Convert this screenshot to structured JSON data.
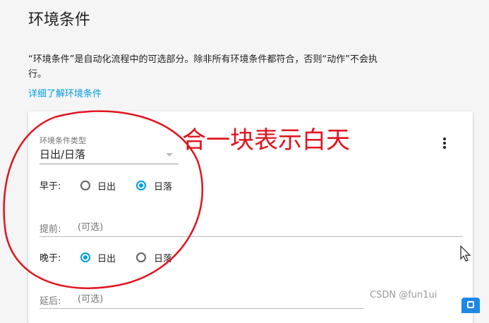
{
  "header": {
    "title": "环境条件",
    "description": "“环境条件”是自动化流程中的可选部分。除非所有环境条件都符合，否则“动作”不会执行。",
    "learn_more": "详细了解环境条件"
  },
  "condition": {
    "type_label": "环境条件类型",
    "type_value": "日出/日落",
    "after": {
      "label": "早于:",
      "options": [
        "日出",
        "日落"
      ],
      "selected": "日落"
    },
    "before_offset": {
      "prefix": "提前:",
      "placeholder": "(可选)"
    },
    "before": {
      "label": "晚于:",
      "options": [
        "日出",
        "日落"
      ],
      "selected": "日出"
    },
    "after_offset": {
      "prefix": "延后:",
      "placeholder": "(可选)"
    }
  },
  "annotation": {
    "text": "合一块表示白天",
    "color": "#e0141e"
  },
  "watermark": {
    "text": "CSDN @fun1ui"
  },
  "colors": {
    "accent": "#039be5",
    "background": "#f5f5f5",
    "card": "#ffffff"
  },
  "icons": [
    "more-vert-icon",
    "mouse-cursor-icon",
    "badge-icon"
  ]
}
